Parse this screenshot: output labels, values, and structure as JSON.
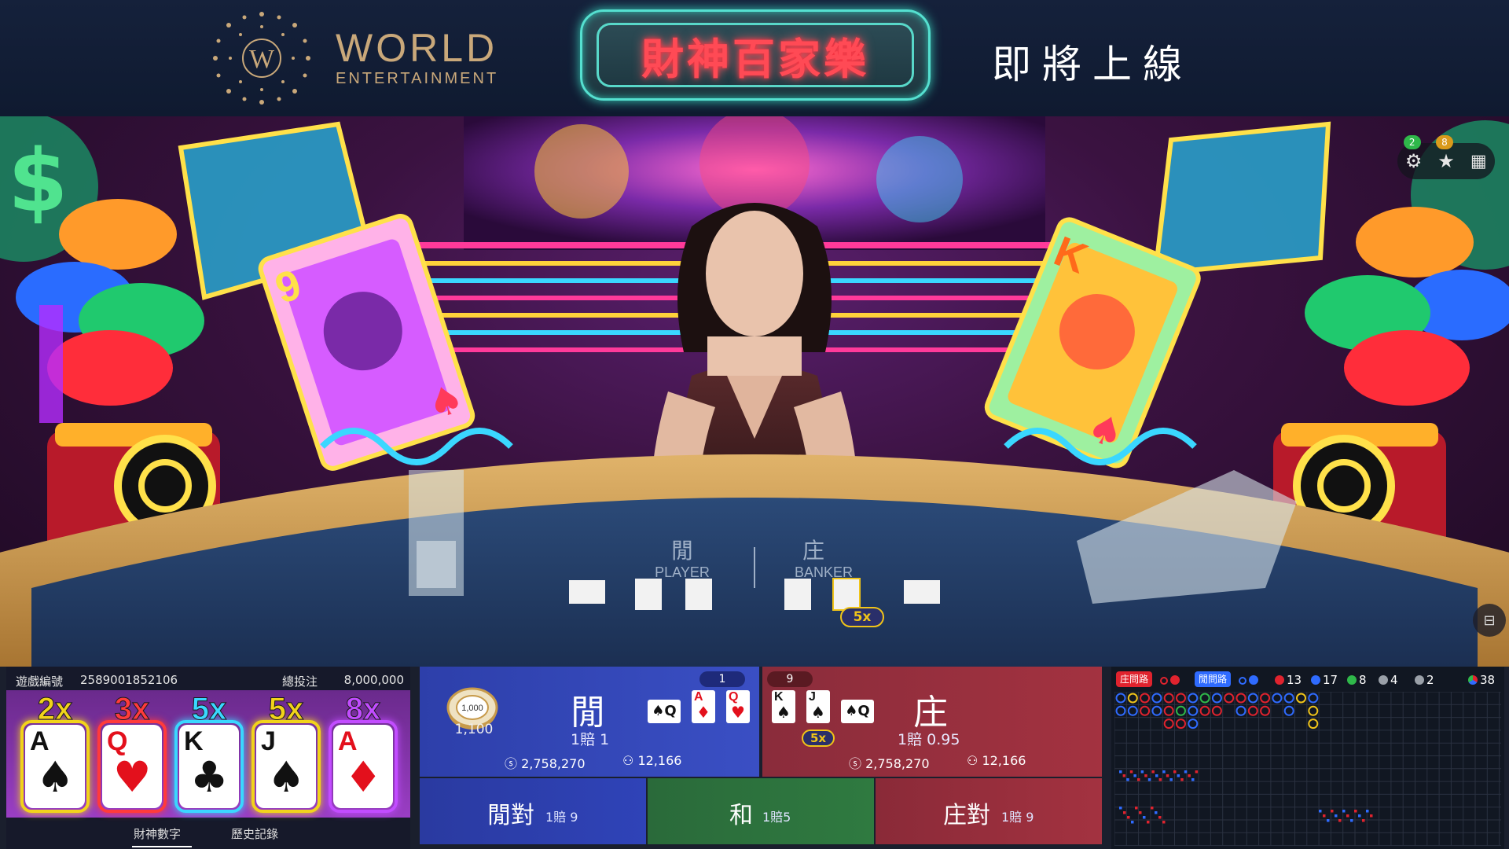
{
  "header": {
    "logo_word": "WORLD",
    "logo_sub": "ENTERTAINMENT",
    "title": "財神百家樂",
    "coming_soon": "即將上線"
  },
  "stage": {
    "badges": {
      "first": "2",
      "second": "8"
    },
    "icons": [
      "gear-icon",
      "star-icon",
      "grid-icon"
    ],
    "table_labels": {
      "player_cn": "閒",
      "player_en": "PLAYER",
      "banker_cn": "庄",
      "banker_en": "BANKER"
    },
    "multiplier_bubble": "5x",
    "backdrop_cards": {
      "left": "9",
      "right": "K"
    }
  },
  "fortune": {
    "game_id_label": "遊戲編號",
    "game_id": "2589001852106",
    "total_label": "總投注",
    "total": "8,000,000",
    "cards": [
      {
        "mult": "2x",
        "rank": "A",
        "suit": "♠",
        "color": "#111111",
        "frame": "#f2d31b"
      },
      {
        "mult": "3x",
        "rank": "Q",
        "suit": "♥",
        "color": "#e3101c",
        "frame": "#ff3b3b"
      },
      {
        "mult": "5x",
        "rank": "K",
        "suit": "♣",
        "color": "#111111",
        "frame": "#3ad7ff"
      },
      {
        "mult": "5x",
        "rank": "J",
        "suit": "♠",
        "color": "#111111",
        "frame": "#f2d31b"
      },
      {
        "mult": "8x",
        "rank": "A",
        "suit": "♦",
        "color": "#e3101c",
        "frame": "#c24cff"
      }
    ],
    "tabs": {
      "active": "財神數字",
      "history": "歷史記錄"
    }
  },
  "player": {
    "score": "1",
    "name": "閒",
    "odds": "1賠 1",
    "amount": "2,758,270",
    "players": "12,166",
    "chip_top": "1,000",
    "chip_value": "1,100",
    "cards": [
      {
        "rank": "Q",
        "suit": "♠",
        "side": true
      },
      {
        "rank": "A",
        "suit": "♦",
        "side": false
      },
      {
        "rank": "Q",
        "suit": "♥",
        "side": false
      }
    ]
  },
  "banker": {
    "score": "9",
    "name": "庄",
    "odds": "1賠 0.95",
    "amount": "2,758,270",
    "players": "12,166",
    "mult": "5x",
    "cards": [
      {
        "rank": "K",
        "suit": "♠",
        "side": false
      },
      {
        "rank": "J",
        "suit": "♠",
        "side": false
      },
      {
        "rank": "Q",
        "suit": "♠",
        "side": true
      }
    ]
  },
  "pairs": [
    {
      "name": "閒對",
      "odds": "1賠 9"
    },
    {
      "name": "和",
      "odds": "1賠5"
    },
    {
      "name": "庄對",
      "odds": "1賠 9"
    }
  ],
  "road": {
    "banker_road_tag": "庄問路",
    "player_road_tag": "閒問路",
    "banker_count": "13",
    "player_count": "17",
    "tie_count": "8",
    "banker_pair_count": "4",
    "player_pair_count": "2",
    "total_count": "38",
    "colors": {
      "banker": "#e0232e",
      "player": "#2f6bff",
      "tie": "#2fb84a",
      "gold": "#f0c419"
    }
  }
}
